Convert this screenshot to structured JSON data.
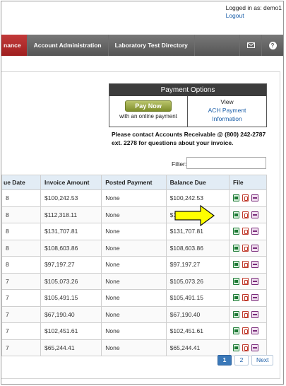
{
  "header": {
    "logged_in_text": "Logged in as: demo1",
    "logout_label": "Logout"
  },
  "nav": {
    "active_partial": "nance",
    "items": [
      "Account Administration",
      "Laboratory Test Directory"
    ]
  },
  "payment_options": {
    "title": "Payment Options",
    "pay_now_label": "Pay Now",
    "pay_now_sub": "with an online payment",
    "view_label": "View",
    "ach_line1": "ACH Payment",
    "ach_line2": "Information"
  },
  "contact_text": "Please contact Accounts Receivable @ (800) 242-2787 ext. 2278 for questions about your invoice.",
  "filter": {
    "label": "Filter:",
    "value": ""
  },
  "table": {
    "headers": [
      "ue Date",
      "Invoice Amount",
      "Posted Payment",
      "Balance Due",
      "File"
    ],
    "rows": [
      {
        "due": "8",
        "amount": "$100,242.53",
        "posted": "None",
        "balance": "$100,242.53"
      },
      {
        "due": "8",
        "amount": "$112,318.11",
        "posted": "None",
        "balance": "$112"
      },
      {
        "due": "8",
        "amount": "$131,707.81",
        "posted": "None",
        "balance": "$131,707.81"
      },
      {
        "due": "8",
        "amount": "$108,603.86",
        "posted": "None",
        "balance": "$108,603.86"
      },
      {
        "due": "8",
        "amount": "$97,197.27",
        "posted": "None",
        "balance": "$97,197.27"
      },
      {
        "due": "7",
        "amount": "$105,073.26",
        "posted": "None",
        "balance": "$105,073.26"
      },
      {
        "due": "7",
        "amount": "$105,491.15",
        "posted": "None",
        "balance": "$105,491.15"
      },
      {
        "due": "7",
        "amount": "$67,190.40",
        "posted": "None",
        "balance": "$67,190.40"
      },
      {
        "due": "7",
        "amount": "$102,451.61",
        "posted": "None",
        "balance": "$102,451.61"
      },
      {
        "due": "7",
        "amount": "$65,244.41",
        "posted": "None",
        "balance": "$65,244.41"
      }
    ]
  },
  "pagination": {
    "pages": [
      "1",
      "2"
    ],
    "current": "1",
    "next_label": "Next"
  },
  "colors": {
    "nav_active": "#b02a2a",
    "highlight_arrow": "#ffff00"
  }
}
